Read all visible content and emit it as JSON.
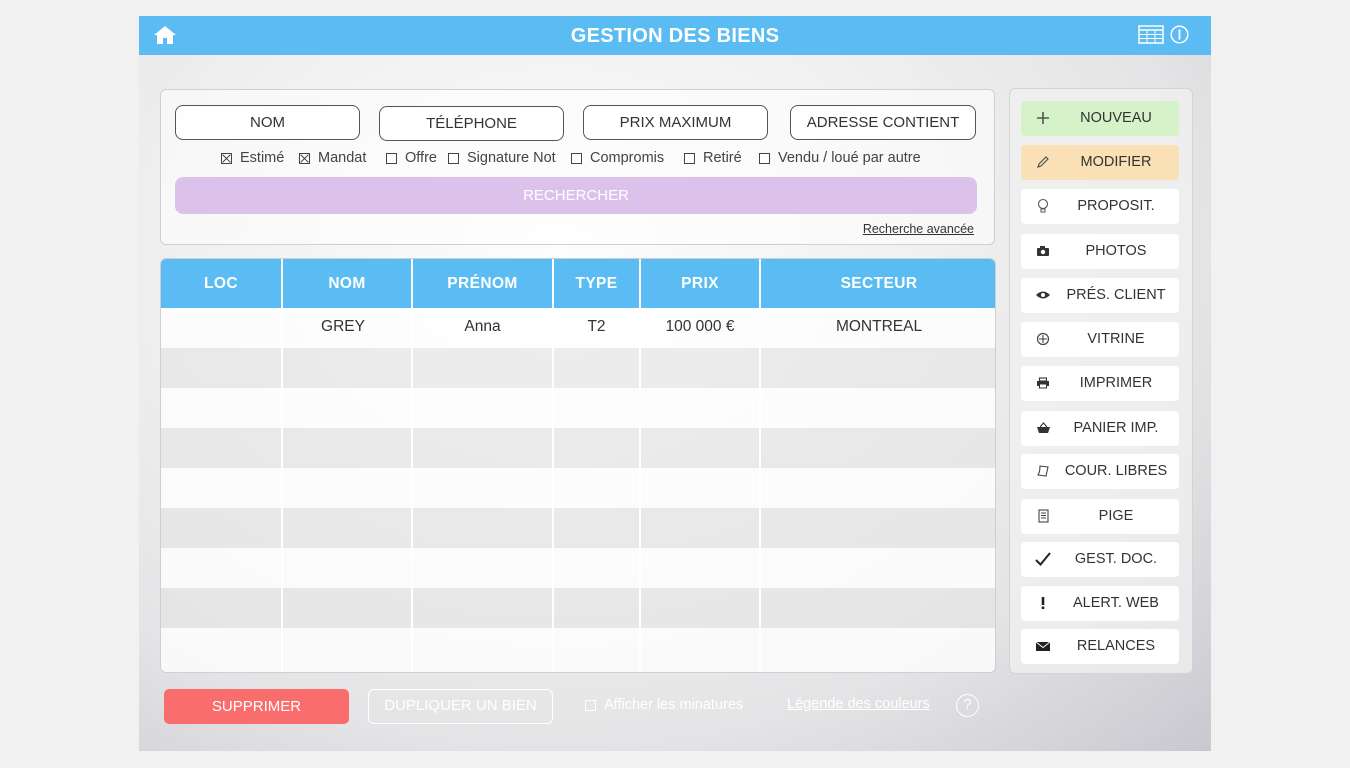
{
  "header": {
    "title": "GESTION DES BIENS"
  },
  "search": {
    "fields": [
      "NOM",
      "TÉLÉPHONE",
      "PRIX MAXIMUM",
      "ADRESSE CONTIENT"
    ],
    "filters": [
      {
        "label": "Estimé",
        "checked": true
      },
      {
        "label": "Mandat",
        "checked": true
      },
      {
        "label": "Offre",
        "checked": false
      },
      {
        "label": "Signature Not",
        "checked": false
      },
      {
        "label": "Compromis",
        "checked": false
      },
      {
        "label": "Retiré",
        "checked": false
      },
      {
        "label": "Vendu / loué par autre",
        "checked": false
      }
    ],
    "search_button": "RECHERCHER",
    "advanced_link": "Recherche avancée"
  },
  "table": {
    "columns": [
      "LOC",
      "NOM",
      "PRÉNOM",
      "TYPE",
      "PRIX",
      "SECTEUR"
    ],
    "rows": [
      [
        "",
        "GREY",
        "Anna",
        "T2",
        "100 000 €",
        "MONTREAL"
      ]
    ]
  },
  "sidebar": {
    "items": [
      {
        "label": "NOUVEAU",
        "icon": "plus-icon",
        "bg": "#d6f2c8"
      },
      {
        "label": "MODIFIER",
        "icon": "pencil-icon",
        "bg": "#f9e0b5"
      },
      {
        "label": "PROPOSIT.",
        "icon": "lightbulb-icon",
        "bg": "#ffffff"
      },
      {
        "label": "PHOTOS",
        "icon": "camera-icon",
        "bg": "#ffffff"
      },
      {
        "label": "PRÉS. CLIENT",
        "icon": "eye-icon",
        "bg": "#ffffff"
      },
      {
        "label": "VITRINE",
        "icon": "crosshair-icon",
        "bg": "#ffffff"
      },
      {
        "label": "IMPRIMER",
        "icon": "printer-icon",
        "bg": "#ffffff"
      },
      {
        "label": "PANIER IMP.",
        "icon": "basket-icon",
        "bg": "#ffffff"
      },
      {
        "label": "COUR. LIBRES",
        "icon": "paper-icon",
        "bg": "#ffffff"
      },
      {
        "label": "PIGE",
        "icon": "document-icon",
        "bg": "#ffffff"
      },
      {
        "label": "GEST. DOC.",
        "icon": "checkmark-icon",
        "bg": "#ffffff"
      },
      {
        "label": "ALERT. WEB",
        "icon": "exclamation-icon",
        "bg": "#ffffff"
      },
      {
        "label": "RELANCES",
        "icon": "envelope-icon",
        "bg": "#ffffff"
      }
    ]
  },
  "footer": {
    "delete_button": "SUPPRIMER",
    "duplicate_button": "DUPLIQUER UN BIEN",
    "thumbnails_label": "Afficher les minatures",
    "legend_link": "Légende des couleurs",
    "help_symbol": "?"
  },
  "colors": {
    "accent": "#5bbcf3",
    "search": "#dcc2eb",
    "delete": "#fa6d6d",
    "new": "#d6f2c8",
    "edit": "#f9e0b5"
  }
}
